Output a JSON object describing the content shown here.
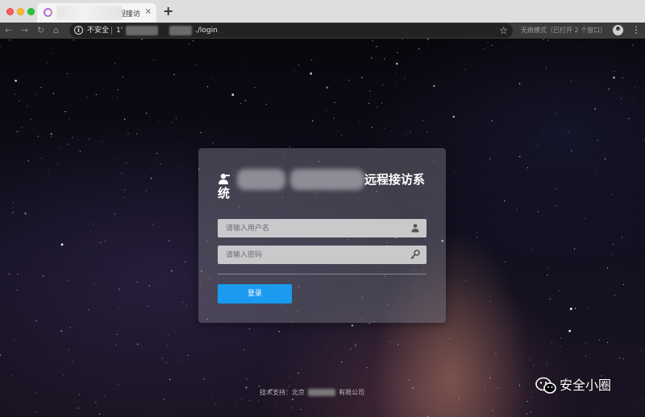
{
  "browser": {
    "tab": {
      "title": "程接访",
      "close_glyph": "×"
    },
    "new_tab_glyph": "+",
    "nav": {
      "back": "←",
      "forward": "→",
      "reload": "↻",
      "home": "⌂"
    },
    "address_bar": {
      "security_label": "不安全",
      "url_prefix": "1'",
      "url_suffix": "./login",
      "icons": [
        "info-icon",
        "star-icon"
      ]
    },
    "incognito_label": "无痕模式（已打开 2 个窗口）",
    "menu_glyph": "⋮"
  },
  "login": {
    "title_head": "统",
    "title_tail": "远程接访系",
    "username_placeholder": "请输入用户名",
    "password_placeholder": "请输入密码",
    "submit_label": "登录",
    "icons": [
      "user-logo-icon",
      "user-icon",
      "key-icon"
    ]
  },
  "footer": {
    "prefix": "技术支持：北京",
    "suffix": "有限公司"
  },
  "watermark": {
    "text": "安全小圈",
    "icon": "wechat-icon"
  },
  "colors": {
    "accent_button": "#1a9bf0",
    "card_background": "rgba(110,110,120,0.52)",
    "chrome_dark": "#3b3b3b"
  }
}
